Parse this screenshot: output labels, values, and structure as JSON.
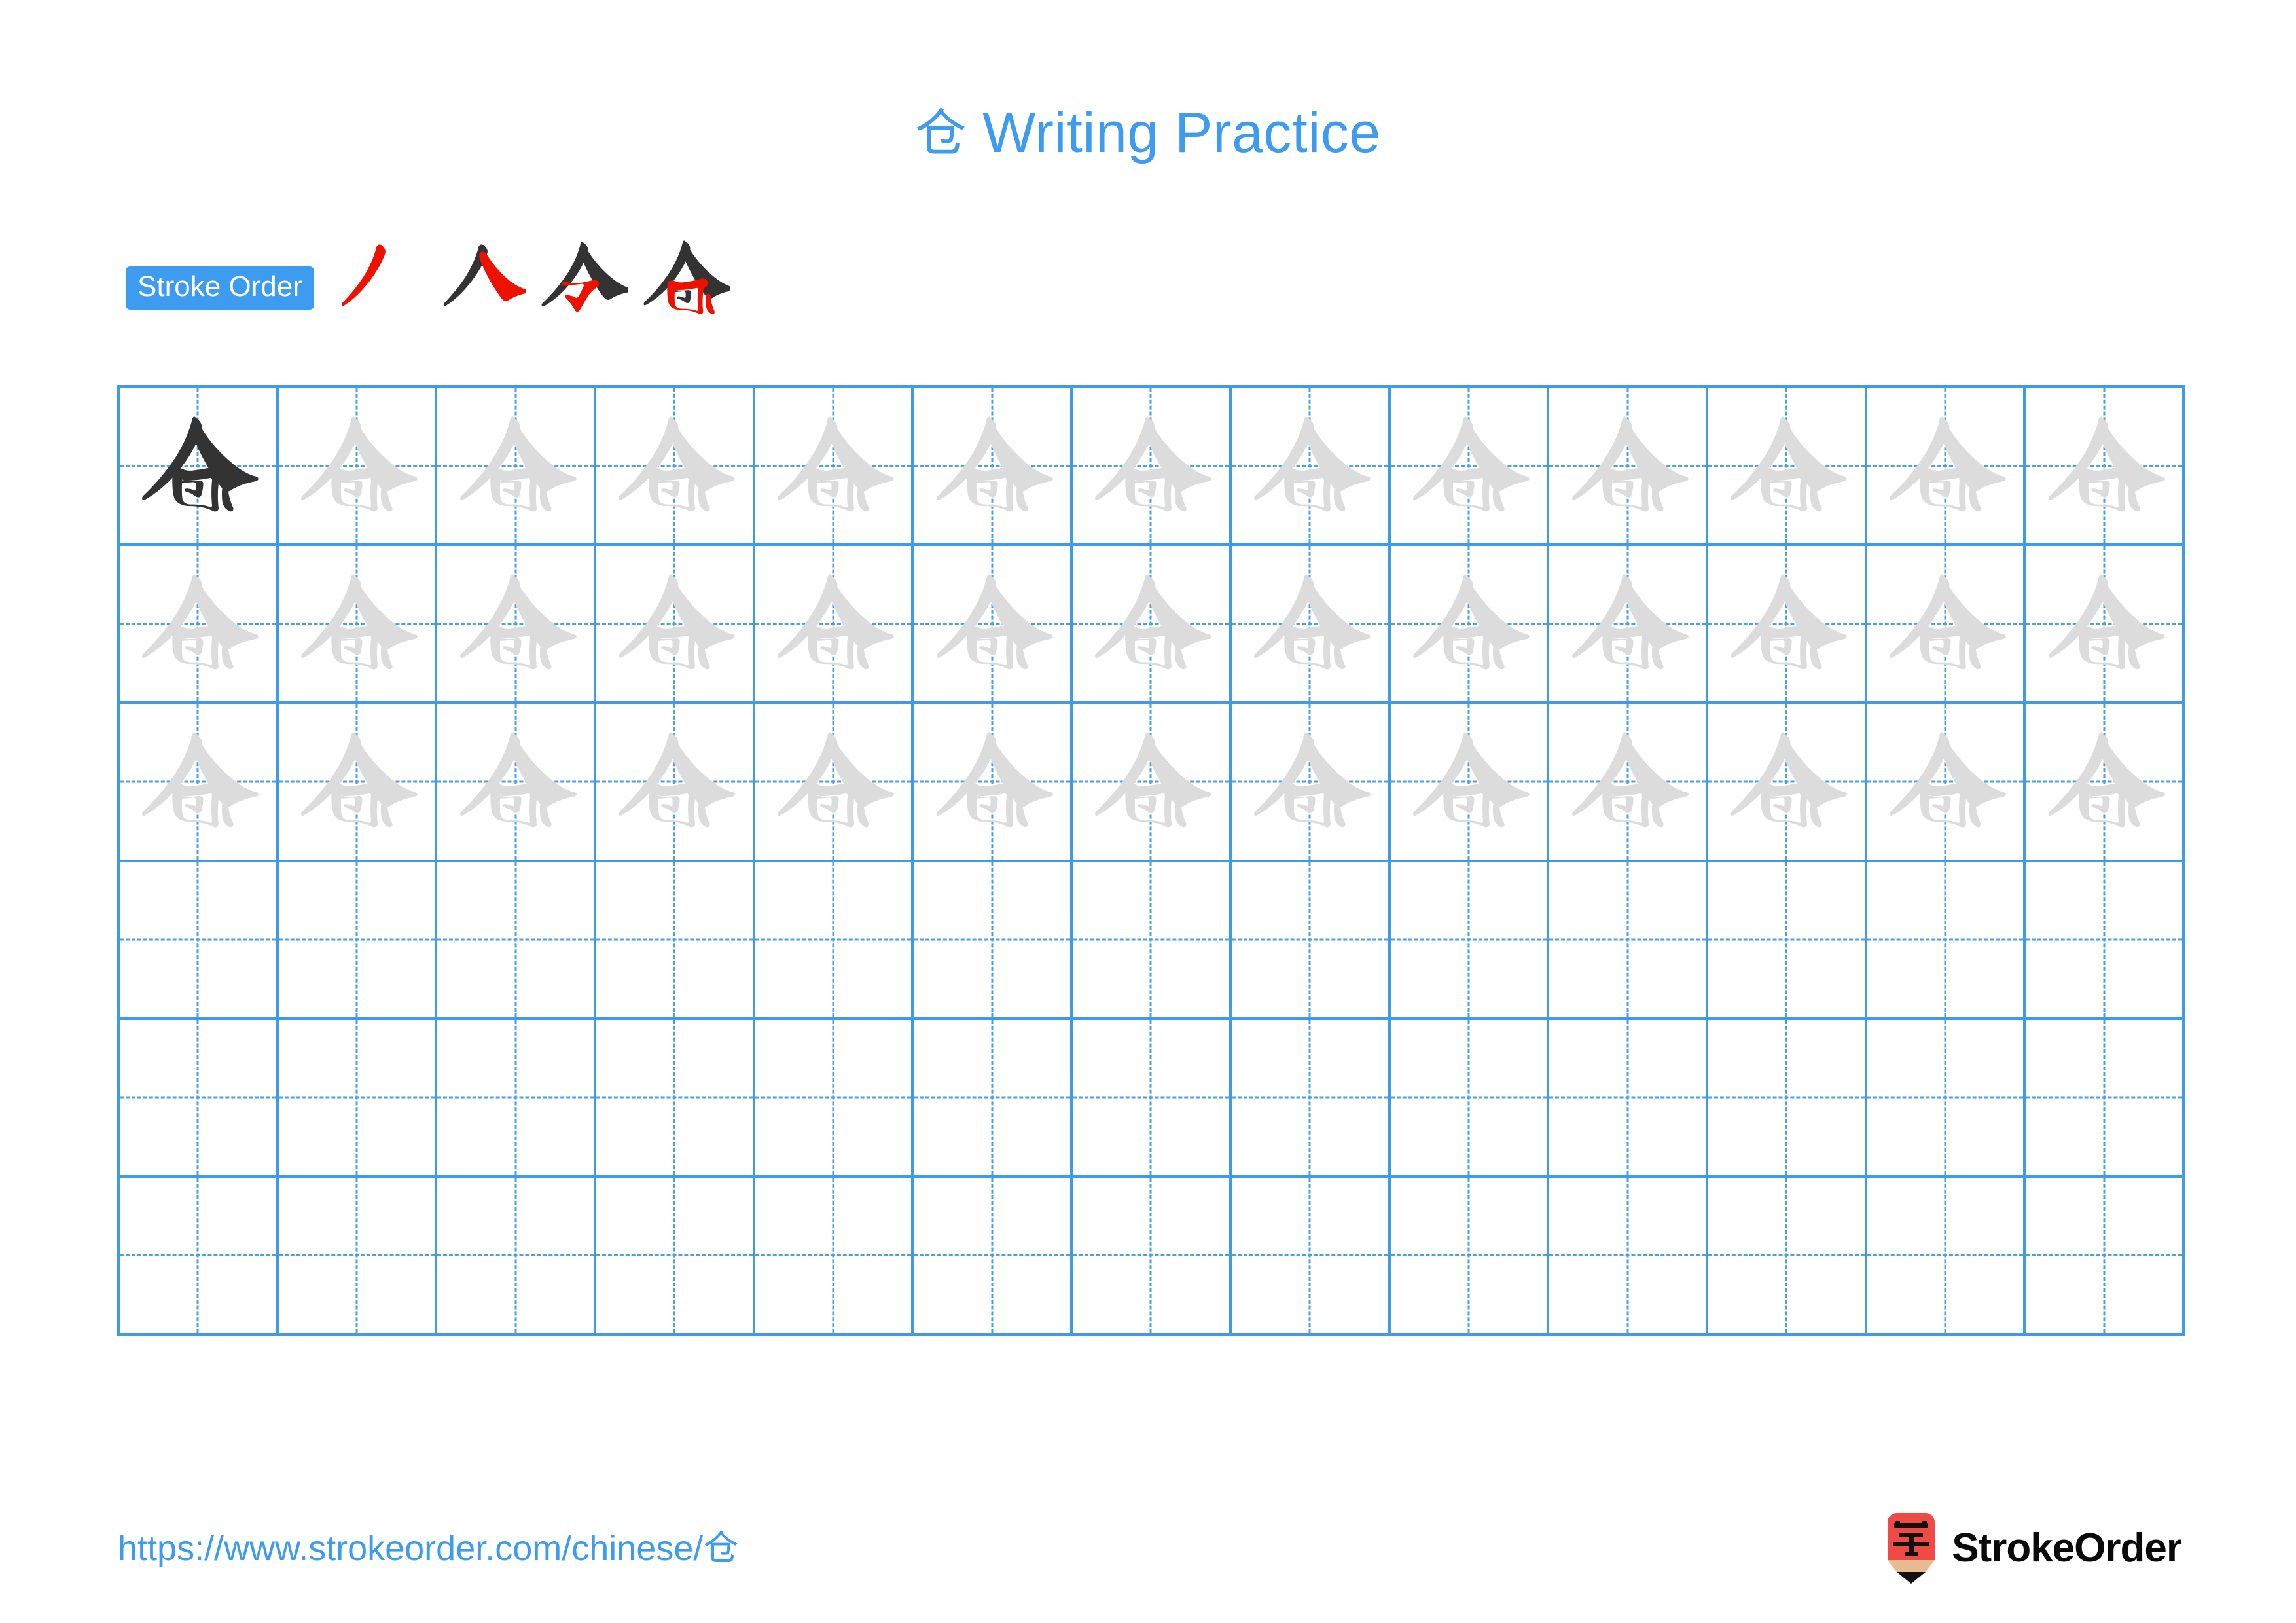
{
  "document": {
    "character": "仓",
    "title_suffix": "Writing Practice",
    "background_color": "#ffffff"
  },
  "header": {
    "title_char": "仓",
    "title_text": "Writing Practice",
    "title_color": "#3d9bf0"
  },
  "stroke_order": {
    "badge_label": "Stroke Order",
    "badge_background": "#3d9bf0",
    "badge_text_color": "#ffffff",
    "total_strokes": 4,
    "new_stroke_color": "#ee1100",
    "previous_stroke_color": "#333333",
    "steps": [
      {
        "index": 1,
        "new_stroke_name": "pie",
        "strokes_shown": 1
      },
      {
        "index": 2,
        "new_stroke_name": "na",
        "strokes_shown": 2
      },
      {
        "index": 3,
        "new_stroke_name": "heng-gou",
        "strokes_shown": 3
      },
      {
        "index": 4,
        "new_stroke_name": "heng-zhe-gou",
        "strokes_shown": 4
      }
    ]
  },
  "practice_grid": {
    "columns": 13,
    "rows": 6,
    "grid_line_color": "#3d9be8",
    "guide_line_color": "#4a9fe8",
    "traced_char_color": "#dcdcdc",
    "model_char_color": "#333333",
    "cells_with_model_char": 1,
    "rows_with_trace_characters": 3,
    "empty_rows": 3
  },
  "footer": {
    "url": "https://www.strokeorder.com/chinese/",
    "url_char": "仓",
    "url_color": "#3d9bf0",
    "brand_name": "StrokeOrder",
    "brand_icon_char": "字",
    "brand_icon_color": "#f04a45",
    "brand_icon_tip_color": "#e8bb93"
  }
}
